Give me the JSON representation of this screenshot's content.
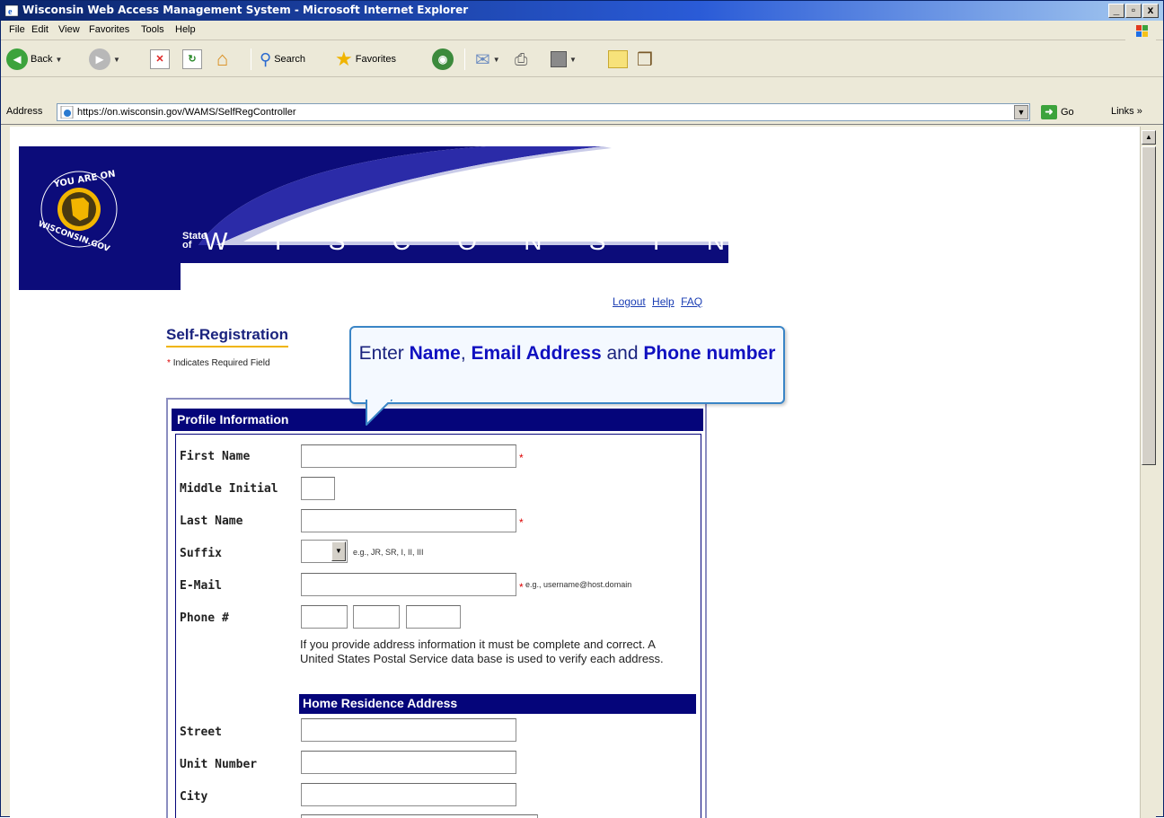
{
  "window": {
    "title": "Wisconsin Web Access Management System - Microsoft Internet Explorer",
    "minimize": "_",
    "maximize": "Ђ",
    "close": "x"
  },
  "menu": [
    "File",
    "Edit",
    "View",
    "Favorites",
    "Tools",
    "Help"
  ],
  "toolbar": {
    "back": "Back",
    "search": "Search",
    "favorites": "Favorites"
  },
  "address": {
    "label": "Address",
    "url": "https://on.wisconsin.gov/WAMS/SelfRegController",
    "go": "Go",
    "links": "Links"
  },
  "banner": {
    "seal_text_top": "YOU ARE ON",
    "seal_text_bottom": "WISCONSIN.GOV",
    "state_of": "State of",
    "state_letters": [
      "W",
      "I",
      "S",
      "C",
      "O",
      "N",
      "S",
      "I",
      "N"
    ]
  },
  "nav": {
    "logout": "Logout",
    "help": "Help",
    "faq": "FAQ"
  },
  "page": {
    "title": "Self-Registration",
    "required_mark": "*",
    "required_note": "Indicates Required Field"
  },
  "callout": {
    "prefix": "Enter ",
    "name": "Name",
    "sep": ", ",
    "email": "Email Address",
    "and": " and ",
    "phone": "Phone number"
  },
  "form": {
    "section_title": "Profile Information",
    "first_name": "First Name",
    "middle_initial": "Middle Initial",
    "last_name": "Last Name",
    "suffix": "Suffix",
    "suffix_hint": "e.g., JR, SR, I, II, III",
    "email": "E-Mail",
    "email_hint": "e.g., username@host.domain",
    "phone": "Phone #",
    "address_note": "If you provide address information it must be complete and correct.  A United States Postal Service data base is used to verify each address.",
    "home_address_title": "Home Residence Address",
    "street": "Street",
    "unit_number": "Unit Number",
    "city": "City"
  }
}
